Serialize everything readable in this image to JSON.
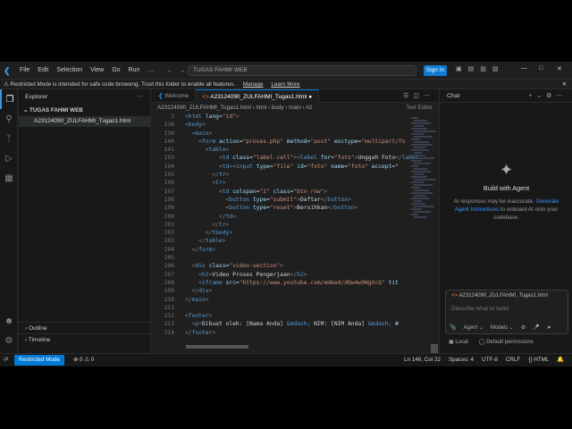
{
  "titlebar": {
    "menus": [
      "File",
      "Edit",
      "Selection",
      "View",
      "Go",
      "Run",
      "…"
    ],
    "search": "TUGAS FAHMI WEB",
    "sign_in": "Sign In"
  },
  "banner": {
    "text": "Restricted Mode is intended for safe code browsing. Trust this folder to enable all features.",
    "manage": "Manage",
    "learn_more": "Learn More"
  },
  "sidebar": {
    "title": "Explorer",
    "folder": "TUGAS FAHMI WEB",
    "file": "A23124090_ZULFAHMI_Tugas1.html",
    "outline": "Outline",
    "timeline": "Timeline"
  },
  "editor": {
    "tabs": [
      {
        "label": "Welcome"
      },
      {
        "label": "A23124090_ZULFAHMI_Tugas1.html"
      }
    ],
    "breadcrumb": [
      "A23124090_ZULFAHMI_Tugas1.html",
      "html",
      "body",
      "main",
      "h2"
    ],
    "text_editor_label": "Text Editor"
  },
  "code": {
    "lines": [
      {
        "n": "2",
        "indent": 0,
        "parts": [
          [
            "p",
            "<"
          ],
          [
            "t",
            "html "
          ],
          [
            "a",
            "lang"
          ],
          [
            "x",
            "="
          ],
          [
            "s",
            "\"id\""
          ],
          [
            "p",
            ">"
          ]
        ]
      },
      {
        "n": "138",
        "indent": 0,
        "parts": [
          [
            "p",
            "<"
          ],
          [
            "t",
            "body"
          ],
          [
            "p",
            ">"
          ]
        ]
      },
      {
        "n": "139",
        "indent": 1,
        "parts": [
          [
            "p",
            "<"
          ],
          [
            "t",
            "main"
          ],
          [
            "p",
            ">"
          ]
        ]
      },
      {
        "n": "140",
        "indent": 2,
        "parts": [
          [
            "p",
            "<"
          ],
          [
            "t",
            "form "
          ],
          [
            "a",
            "action"
          ],
          [
            "x",
            "="
          ],
          [
            "s",
            "\"proses.php\" "
          ],
          [
            "a",
            "method"
          ],
          [
            "x",
            "="
          ],
          [
            "s",
            "\"post\" "
          ],
          [
            "a",
            "enctype"
          ],
          [
            "x",
            "="
          ],
          [
            "s",
            "\"multipart/fo"
          ]
        ]
      },
      {
        "n": "141",
        "indent": 3,
        "parts": [
          [
            "p",
            "<"
          ],
          [
            "t",
            "table"
          ],
          [
            "p",
            ">"
          ]
        ]
      },
      {
        "n": "193",
        "indent": 5,
        "parts": [
          [
            "p",
            "<"
          ],
          [
            "t",
            "td "
          ],
          [
            "a",
            "class"
          ],
          [
            "x",
            "="
          ],
          [
            "s",
            "\"label-cell\""
          ],
          [
            "p",
            "><"
          ],
          [
            "t",
            "label "
          ],
          [
            "a",
            "for"
          ],
          [
            "x",
            "="
          ],
          [
            "s",
            "\"foto\""
          ],
          [
            "p",
            ">"
          ],
          [
            "x",
            "Unggah Foto"
          ],
          [
            "p",
            "</"
          ],
          [
            "t",
            "label"
          ]
        ]
      },
      {
        "n": "194",
        "indent": 5,
        "parts": [
          [
            "p",
            "<"
          ],
          [
            "t",
            "td"
          ],
          [
            "p",
            "><"
          ],
          [
            "t",
            "input "
          ],
          [
            "a",
            "type"
          ],
          [
            "x",
            "="
          ],
          [
            "s",
            "\"file\" "
          ],
          [
            "a",
            "id"
          ],
          [
            "x",
            "="
          ],
          [
            "s",
            "\"foto\" "
          ],
          [
            "a",
            "name"
          ],
          [
            "x",
            "="
          ],
          [
            "s",
            "\"foto\" "
          ],
          [
            "a",
            "accept"
          ],
          [
            "x",
            "=\""
          ]
        ]
      },
      {
        "n": "195",
        "indent": 4,
        "parts": [
          [
            "p",
            "</"
          ],
          [
            "t",
            "tr"
          ],
          [
            "p",
            ">"
          ]
        ]
      },
      {
        "n": "196",
        "indent": 4,
        "parts": [
          [
            "p",
            "<"
          ],
          [
            "t",
            "tr"
          ],
          [
            "p",
            ">"
          ]
        ]
      },
      {
        "n": "197",
        "indent": 5,
        "parts": [
          [
            "p",
            "<"
          ],
          [
            "t",
            "td "
          ],
          [
            "a",
            "colspan"
          ],
          [
            "x",
            "="
          ],
          [
            "s",
            "\"2\" "
          ],
          [
            "a",
            "class"
          ],
          [
            "x",
            "="
          ],
          [
            "s",
            "\"btn-row\""
          ],
          [
            "p",
            ">"
          ]
        ]
      },
      {
        "n": "198",
        "indent": 6,
        "parts": [
          [
            "p",
            "<"
          ],
          [
            "t",
            "button "
          ],
          [
            "a",
            "type"
          ],
          [
            "x",
            "="
          ],
          [
            "s",
            "\"submit\""
          ],
          [
            "p",
            ">"
          ],
          [
            "x",
            "Daftar"
          ],
          [
            "p",
            "</"
          ],
          [
            "t",
            "button"
          ],
          [
            "p",
            ">"
          ]
        ]
      },
      {
        "n": "199",
        "indent": 6,
        "parts": [
          [
            "p",
            "<"
          ],
          [
            "t",
            "button "
          ],
          [
            "a",
            "type"
          ],
          [
            "x",
            "="
          ],
          [
            "s",
            "\"reset\""
          ],
          [
            "p",
            ">"
          ],
          [
            "x",
            "Bersihkan"
          ],
          [
            "p",
            "</"
          ],
          [
            "t",
            "button"
          ],
          [
            "p",
            ">"
          ]
        ]
      },
      {
        "n": "200",
        "indent": 5,
        "parts": [
          [
            "p",
            "</"
          ],
          [
            "t",
            "td"
          ],
          [
            "p",
            ">"
          ]
        ]
      },
      {
        "n": "201",
        "indent": 4,
        "parts": [
          [
            "p",
            "</"
          ],
          [
            "t",
            "tr"
          ],
          [
            "p",
            ">"
          ]
        ]
      },
      {
        "n": "202",
        "indent": 3,
        "parts": [
          [
            "p",
            "</"
          ],
          [
            "t",
            "tbody"
          ],
          [
            "p",
            ">"
          ]
        ]
      },
      {
        "n": "203",
        "indent": 2,
        "parts": [
          [
            "p",
            "</"
          ],
          [
            "t",
            "table"
          ],
          [
            "p",
            ">"
          ]
        ]
      },
      {
        "n": "204",
        "indent": 1,
        "parts": [
          [
            "p",
            "</"
          ],
          [
            "t",
            "form"
          ],
          [
            "p",
            ">"
          ]
        ]
      },
      {
        "n": "205",
        "indent": 0,
        "parts": []
      },
      {
        "n": "206",
        "indent": 1,
        "parts": [
          [
            "p",
            "<"
          ],
          [
            "t",
            "div "
          ],
          [
            "a",
            "class"
          ],
          [
            "x",
            "="
          ],
          [
            "s",
            "\"video-section\""
          ],
          [
            "p",
            ">"
          ]
        ]
      },
      {
        "n": "207",
        "indent": 2,
        "parts": [
          [
            "p",
            "<"
          ],
          [
            "t",
            "h2"
          ],
          [
            "p",
            ">"
          ],
          [
            "x",
            "Video Proses Pengerjaan"
          ],
          [
            "p",
            "</"
          ],
          [
            "t",
            "h2"
          ],
          [
            "p",
            ">"
          ]
        ]
      },
      {
        "n": "208",
        "indent": 2,
        "parts": [
          [
            "p",
            "<"
          ],
          [
            "t",
            "iframe "
          ],
          [
            "a",
            "src"
          ],
          [
            "x",
            "="
          ],
          [
            "s",
            "\"https://www.youtube.com/embed/dQw4w9WgXcQ\" "
          ],
          [
            "a",
            "tit"
          ]
        ]
      },
      {
        "n": "209",
        "indent": 1,
        "parts": [
          [
            "p",
            "</"
          ],
          [
            "t",
            "div"
          ],
          [
            "p",
            ">"
          ]
        ]
      },
      {
        "n": "210",
        "indent": 0,
        "parts": [
          [
            "p",
            "</"
          ],
          [
            "t",
            "main"
          ],
          [
            "p",
            ">"
          ]
        ]
      },
      {
        "n": "211",
        "indent": 0,
        "parts": []
      },
      {
        "n": "212",
        "indent": 0,
        "parts": [
          [
            "p",
            "<"
          ],
          [
            "t",
            "footer"
          ],
          [
            "p",
            ">"
          ]
        ]
      },
      {
        "n": "213",
        "indent": 1,
        "parts": [
          [
            "p",
            "<"
          ],
          [
            "t",
            "p"
          ],
          [
            "p",
            ">"
          ],
          [
            "x",
            "Dibuat oleh: [Nama Anda] "
          ],
          [
            "t",
            "&mdash;"
          ],
          [
            "x",
            " NIM: [NIM Anda] "
          ],
          [
            "t",
            "&mdash;"
          ],
          [
            "x",
            " #"
          ]
        ]
      },
      {
        "n": "214",
        "indent": 0,
        "parts": [
          [
            "p",
            "</"
          ],
          [
            "t",
            "footer"
          ],
          [
            "p",
            ">"
          ]
        ]
      }
    ]
  },
  "chat": {
    "title": "Chat",
    "agent_title": "Build with Agent",
    "desc_1": "AI responses may be inaccurate.",
    "desc_link": "Generate Agent Instructions",
    "desc_2": "to onboard AI onto your codebase.",
    "attached_file": "A23124090_ZULFAHMI_Tugas1.html",
    "input_placeholder": "Describe what to build",
    "agent_label": "Agent",
    "models_label": "Models",
    "local_label": "Local",
    "permissions_label": "Default permissions"
  },
  "status": {
    "restricted": "Restricted Mode",
    "problems": "⊗ 0 ⚠ 0",
    "position": "Ln 146, Col 22",
    "spaces": "Spaces: 4",
    "encoding": "UTF-8",
    "eol": "CRLF",
    "language": "{} HTML"
  }
}
